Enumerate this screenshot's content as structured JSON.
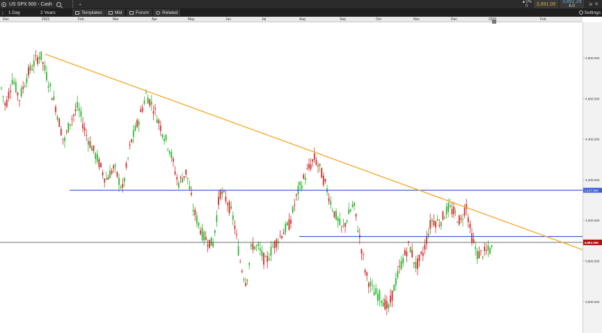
{
  "window": {
    "tab_title": "US SPX 500 - Cash",
    "change_pct": "0%",
    "change_val": "0",
    "bid": "3,891.09",
    "ask": "3,892.29",
    "spread": "6.0"
  },
  "toolbar": {
    "interval": "1 Day",
    "period": "2 Years",
    "templates": "Templates",
    "price_type": "Mid",
    "forum": "Forum",
    "related": "Related",
    "settings": "Settings"
  },
  "x_axis_labels": [
    "Dec",
    "2022",
    "Feb",
    "Mar",
    "Apr",
    "May",
    "Jun",
    "Jul",
    "Aug",
    "Sep",
    "Oct",
    "Nov",
    "Dec",
    "2023",
    "Feb"
  ],
  "y_axis_labels": [
    "4,800.000",
    "4,600.000",
    "4,400.000",
    "4,200.000",
    "4,000.000",
    "3,800.000",
    "3,600.000"
  ],
  "price_tags": {
    "resistance": "4,147.862",
    "current": "3,891.090"
  },
  "colors": {
    "up": "#2db52d",
    "down": "#d62828",
    "trendline": "#f5a623",
    "support": "#3c5fd6",
    "current_tag": "#b01010"
  },
  "chart_data": {
    "type": "candlestick",
    "x_range": [
      "2021-12",
      "2023-02"
    ],
    "ylim": [
      3550,
      4900
    ],
    "trendline": {
      "from": [
        "2022-01-04",
        4818
      ],
      "to": [
        "2023-01-31",
        3890
      ]
    },
    "horizontal_levels": [
      4147.862,
      3920,
      3891.09
    ],
    "notable_points": [
      {
        "date": "2022-01-04",
        "price": 4818,
        "label": "high"
      },
      {
        "date": "2022-08-16",
        "price": 4325
      },
      {
        "date": "2022-10-13",
        "price": 3492,
        "label": "low"
      },
      {
        "date": "2022-12-13",
        "price": 4100
      },
      {
        "date": "2023-01-04",
        "price": 3891
      }
    ]
  }
}
